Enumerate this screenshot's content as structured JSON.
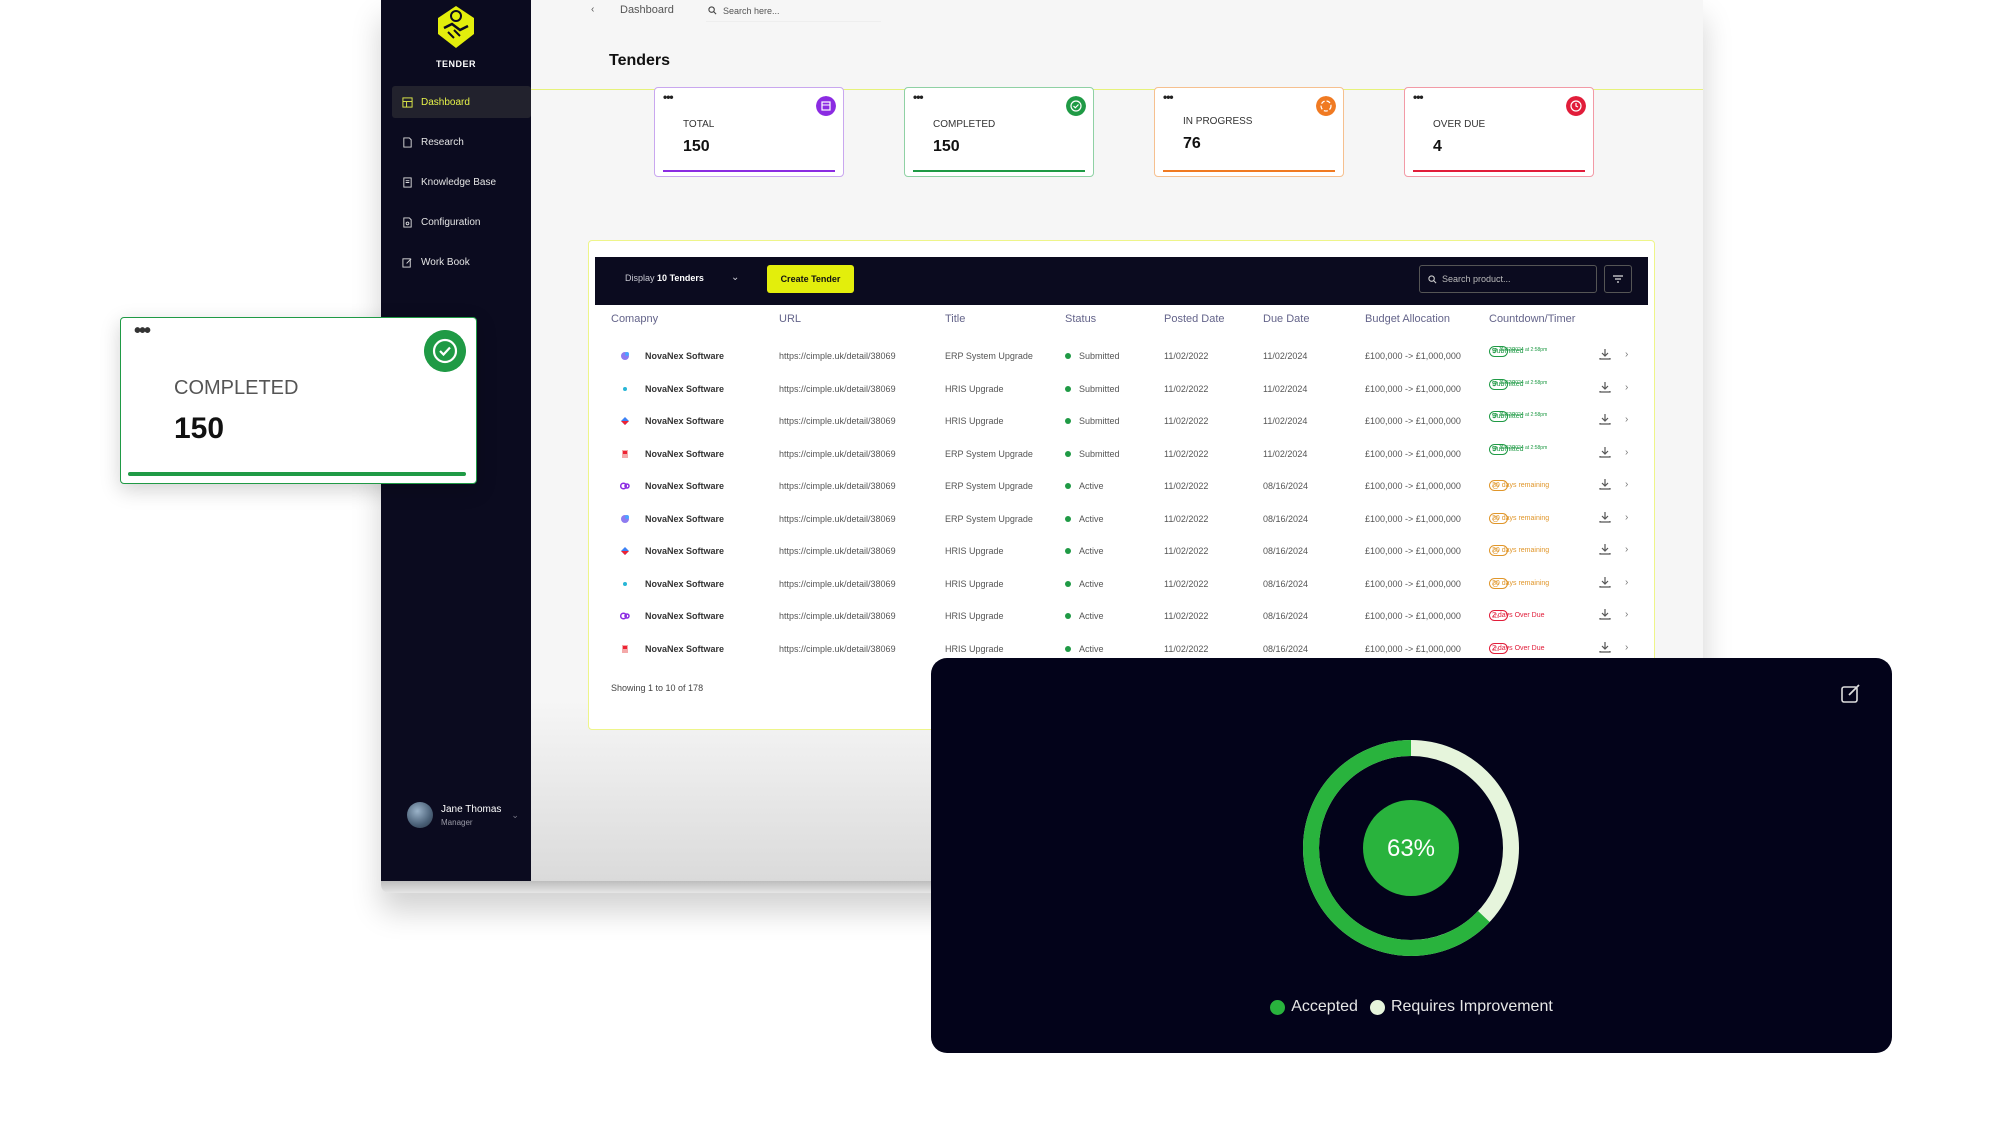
{
  "app": {
    "logo_text": "TENDER"
  },
  "nav": [
    {
      "label": "Dashboard",
      "icon": "grid-icon",
      "active": true
    },
    {
      "label": "Research",
      "icon": "document-icon"
    },
    {
      "label": "Knowledge Base",
      "icon": "book-icon"
    },
    {
      "label": "Configuration",
      "icon": "file-settings-icon"
    },
    {
      "label": "Work Book",
      "icon": "edit-icon"
    }
  ],
  "user": {
    "name": "Jane Thomas",
    "role": "Manager"
  },
  "topbar": {
    "breadcrumb": "Dashboard",
    "search_placeholder": "Search here..."
  },
  "page": {
    "title": "Tenders"
  },
  "stats": [
    {
      "label": "TOTAL",
      "value": "150",
      "color": "#8b2be2"
    },
    {
      "label": "COMPLETED",
      "value": "150",
      "color": "#1f9a45"
    },
    {
      "label": "IN PROGRESS",
      "value": "76",
      "color": "#f07a22"
    },
    {
      "label": "OVER DUE",
      "value": "4",
      "color": "#e11d3a"
    }
  ],
  "table": {
    "display_prefix": "Display",
    "display_count": "10",
    "display_suffix": "Tenders",
    "create_label": "Create Tender",
    "search_placeholder": "Search product...",
    "headers": [
      "Comapny",
      "URL",
      "Title",
      "Status",
      "Posted Date",
      "Due Date",
      "Budget Allocation",
      "Countdown/Timer"
    ],
    "rows": [
      {
        "company": "NovaNex Software",
        "url": "https://cimple.uk/detail/38069",
        "title": "ERP System Upgrade",
        "status": "Submitted",
        "posted": "11/02/2022",
        "due": "11/02/2024",
        "budget": "£100,000 -> £1,000,000",
        "timer": "Submitted",
        "timer_sub": "on 11/02/2024 at 2:58pm",
        "kind": "submitted"
      },
      {
        "company": "NovaNex Software",
        "url": "https://cimple.uk/detail/38069",
        "title": "HRIS Upgrade",
        "status": "Submitted",
        "posted": "11/02/2022",
        "due": "11/02/2024",
        "budget": "£100,000 -> £1,000,000",
        "timer": "Submitted",
        "timer_sub": "on 11/02/2024 at 2:58pm",
        "kind": "submitted"
      },
      {
        "company": "NovaNex Software",
        "url": "https://cimple.uk/detail/38069",
        "title": "HRIS Upgrade",
        "status": "Submitted",
        "posted": "11/02/2022",
        "due": "11/02/2024",
        "budget": "£100,000 -> £1,000,000",
        "timer": "Submitted",
        "timer_sub": "on 11/02/2024 at 2:58pm",
        "kind": "submitted"
      },
      {
        "company": "NovaNex Software",
        "url": "https://cimple.uk/detail/38069",
        "title": "ERP System Upgrade",
        "status": "Submitted",
        "posted": "11/02/2022",
        "due": "11/02/2024",
        "budget": "£100,000 -> £1,000,000",
        "timer": "Submitted",
        "timer_sub": "on 11/02/2024 at 2:58pm",
        "kind": "submitted"
      },
      {
        "company": "NovaNex Software",
        "url": "https://cimple.uk/detail/38069",
        "title": "ERP System Upgrade",
        "status": "Active",
        "posted": "11/02/2022",
        "due": "08/16/2024",
        "budget": "£100,000 -> £1,000,000",
        "timer": "20 days remaining",
        "kind": "remaining"
      },
      {
        "company": "NovaNex Software",
        "url": "https://cimple.uk/detail/38069",
        "title": "ERP System Upgrade",
        "status": "Active",
        "posted": "11/02/2022",
        "due": "08/16/2024",
        "budget": "£100,000 -> £1,000,000",
        "timer": "20 days remaining",
        "kind": "remaining"
      },
      {
        "company": "NovaNex Software",
        "url": "https://cimple.uk/detail/38069",
        "title": "HRIS Upgrade",
        "status": "Active",
        "posted": "11/02/2022",
        "due": "08/16/2024",
        "budget": "£100,000 -> £1,000,000",
        "timer": "20 days remaining",
        "kind": "remaining"
      },
      {
        "company": "NovaNex Software",
        "url": "https://cimple.uk/detail/38069",
        "title": "HRIS Upgrade",
        "status": "Active",
        "posted": "11/02/2022",
        "due": "08/16/2024",
        "budget": "£100,000 -> £1,000,000",
        "timer": "20 days remaining",
        "kind": "remaining"
      },
      {
        "company": "NovaNex Software",
        "url": "https://cimple.uk/detail/38069",
        "title": "HRIS Upgrade",
        "status": "Active",
        "posted": "11/02/2022",
        "due": "08/16/2024",
        "budget": "£100,000 -> £1,000,000",
        "timer": "2 days Over Due",
        "kind": "overdue"
      },
      {
        "company": "NovaNex Software",
        "url": "https://cimple.uk/detail/38069",
        "title": "HRIS Upgrade",
        "status": "Active",
        "posted": "11/02/2022",
        "due": "08/16/2024",
        "budget": "£100,000 -> £1,000,000",
        "timer": "2 days Over Due",
        "kind": "overdue"
      }
    ],
    "footer": "Showing 1 to 10 of 178"
  },
  "completed_card": {
    "label": "COMPLETED",
    "value": "150"
  },
  "progress": {
    "value_label": "63%",
    "accepted_fraction": 0.63,
    "legend": [
      "Accepted",
      "Requires Improvement"
    ],
    "colors": {
      "accepted": "#29b33d",
      "requires_improvement": "#e6f5dc"
    }
  }
}
